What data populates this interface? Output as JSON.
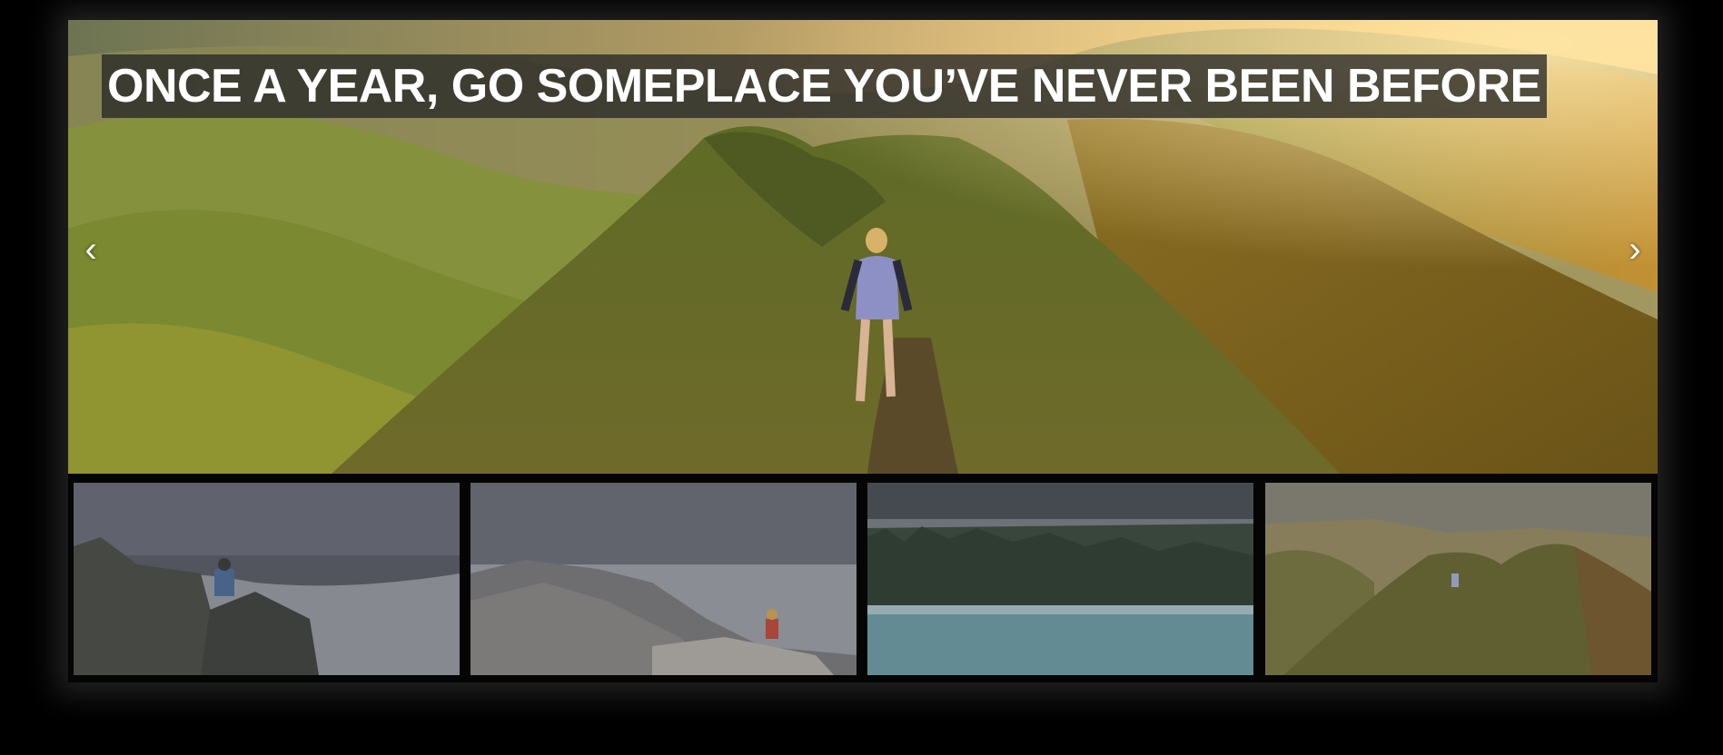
{
  "gallery": {
    "caption": "ONCE A YEAR, GO SOMEPLACE YOU’VE NEVER BEEN BEFORE",
    "prev_label": "‹",
    "next_label": "›",
    "active_index": 0,
    "thumbnails": [
      {
        "name": "thumbnail-photographer-cliff"
      },
      {
        "name": "thumbnail-rocky-mountain-hiker"
      },
      {
        "name": "thumbnail-misty-forest-lake"
      },
      {
        "name": "thumbnail-ridge-trail-hiker"
      }
    ]
  },
  "colors": {
    "background": "#000000",
    "caption_bg": "#282828",
    "caption_text": "#ffffff"
  }
}
